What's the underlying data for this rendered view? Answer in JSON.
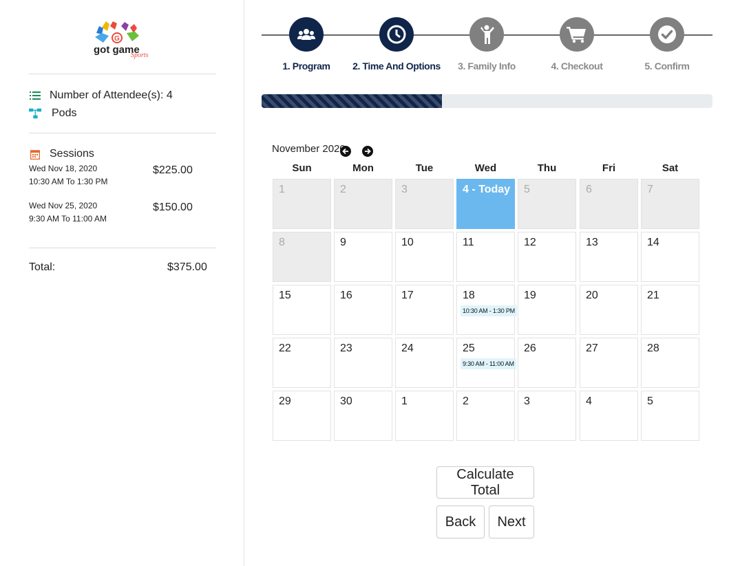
{
  "brand": {
    "logo_text": "got game",
    "logo_script": "Sports"
  },
  "sidebar": {
    "attendees_label": "Number of Attendee(s): 4",
    "pods_label": "Pods",
    "sessions_label": "Sessions",
    "sessions": [
      {
        "date": "Wed Nov 18, 2020",
        "time": "10:30 AM To 1:30 PM",
        "price": "$225.00"
      },
      {
        "date": "Wed Nov 25, 2020",
        "time": "9:30 AM To 11:00 AM",
        "price": "$150.00"
      }
    ],
    "total_label": "Total:",
    "total_value": "$375.00"
  },
  "steps": [
    {
      "label": "1. Program",
      "icon": "users-icon",
      "active": true
    },
    {
      "label": "2. Time And Options",
      "icon": "clock-icon",
      "active": true
    },
    {
      "label": "3. Family Info",
      "icon": "person-icon",
      "active": false
    },
    {
      "label": "4. Checkout",
      "icon": "cart-icon",
      "active": false
    },
    {
      "label": "5. Confirm",
      "icon": "check-icon",
      "active": false
    }
  ],
  "progress": {
    "fraction": 0.4
  },
  "calendar": {
    "month_label": "November 2020",
    "days_of_week": [
      "Sun",
      "Mon",
      "Tue",
      "Wed",
      "Thu",
      "Fri",
      "Sat"
    ],
    "weeks": [
      [
        {
          "d": "1",
          "s": "muted"
        },
        {
          "d": "2",
          "s": "muted"
        },
        {
          "d": "3",
          "s": "muted"
        },
        {
          "d": "4 - Today",
          "s": "today"
        },
        {
          "d": "5",
          "s": "muted"
        },
        {
          "d": "6",
          "s": "muted"
        },
        {
          "d": "7",
          "s": "muted"
        }
      ],
      [
        {
          "d": "8",
          "s": "muted"
        },
        {
          "d": "9"
        },
        {
          "d": "10"
        },
        {
          "d": "11"
        },
        {
          "d": "12"
        },
        {
          "d": "13"
        },
        {
          "d": "14"
        }
      ],
      [
        {
          "d": "15"
        },
        {
          "d": "16"
        },
        {
          "d": "17"
        },
        {
          "d": "18",
          "ev": "10:30 AM - 1:30 PM"
        },
        {
          "d": "19"
        },
        {
          "d": "20"
        },
        {
          "d": "21"
        }
      ],
      [
        {
          "d": "22"
        },
        {
          "d": "23"
        },
        {
          "d": "24"
        },
        {
          "d": "25",
          "ev": "9:30 AM - 11:00 AM"
        },
        {
          "d": "26"
        },
        {
          "d": "27"
        },
        {
          "d": "28"
        }
      ],
      [
        {
          "d": "29"
        },
        {
          "d": "30"
        },
        {
          "d": "1"
        },
        {
          "d": "2"
        },
        {
          "d": "3"
        },
        {
          "d": "4"
        },
        {
          "d": "5"
        }
      ]
    ]
  },
  "buttons": {
    "calculate": "Calculate Total",
    "back": "Back",
    "next": "Next"
  },
  "colors": {
    "navy": "#10254a",
    "inactive": "#808080",
    "today": "#6bb8ee",
    "event_bg": "#dff4fb",
    "muted_cell": "#ececec"
  }
}
